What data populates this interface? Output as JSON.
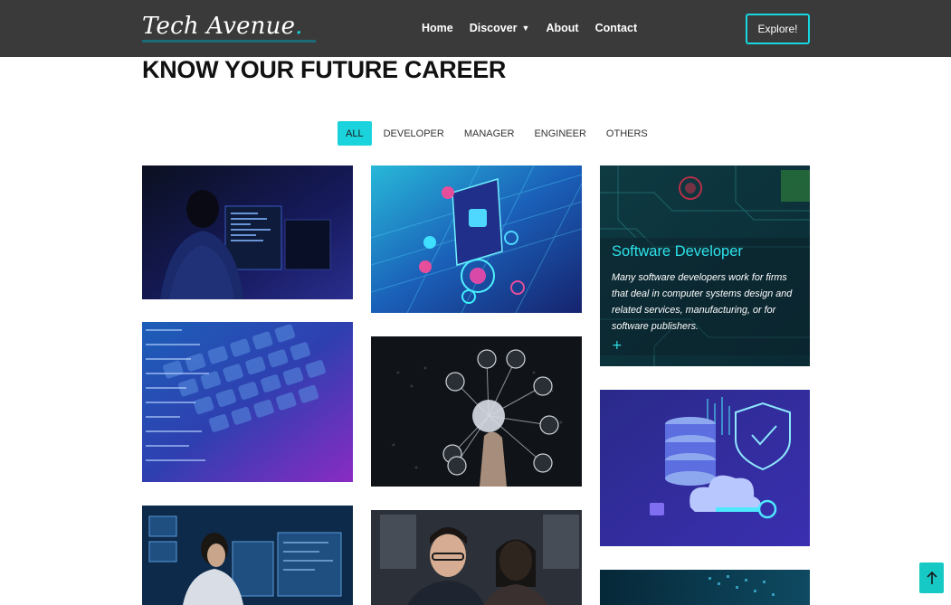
{
  "header": {
    "brand": "Tech Avenue",
    "brand_dot": ".",
    "nav": [
      {
        "label": "Home"
      },
      {
        "label": "Discover"
      },
      {
        "label": "About"
      },
      {
        "label": "Contact"
      }
    ],
    "explore_label": "Explore!"
  },
  "section": {
    "title": "KNOW YOUR FUTURE CAREER"
  },
  "filters": [
    "ALL",
    "DEVELOPER",
    "MANAGER",
    "ENGINEER",
    "OTHERS"
  ],
  "featured": {
    "title": "Software Developer",
    "text": "Many software developers work for firms that deal in computer systems design and related services, manufacturing, or for software publishers.",
    "plus": "+"
  },
  "colors": {
    "accent": "#16d6e0",
    "header_bg": "#3a3a3a"
  },
  "icons": {
    "discover_chevron": "chevron-down-icon",
    "back_to_top": "arrow-up-icon"
  }
}
